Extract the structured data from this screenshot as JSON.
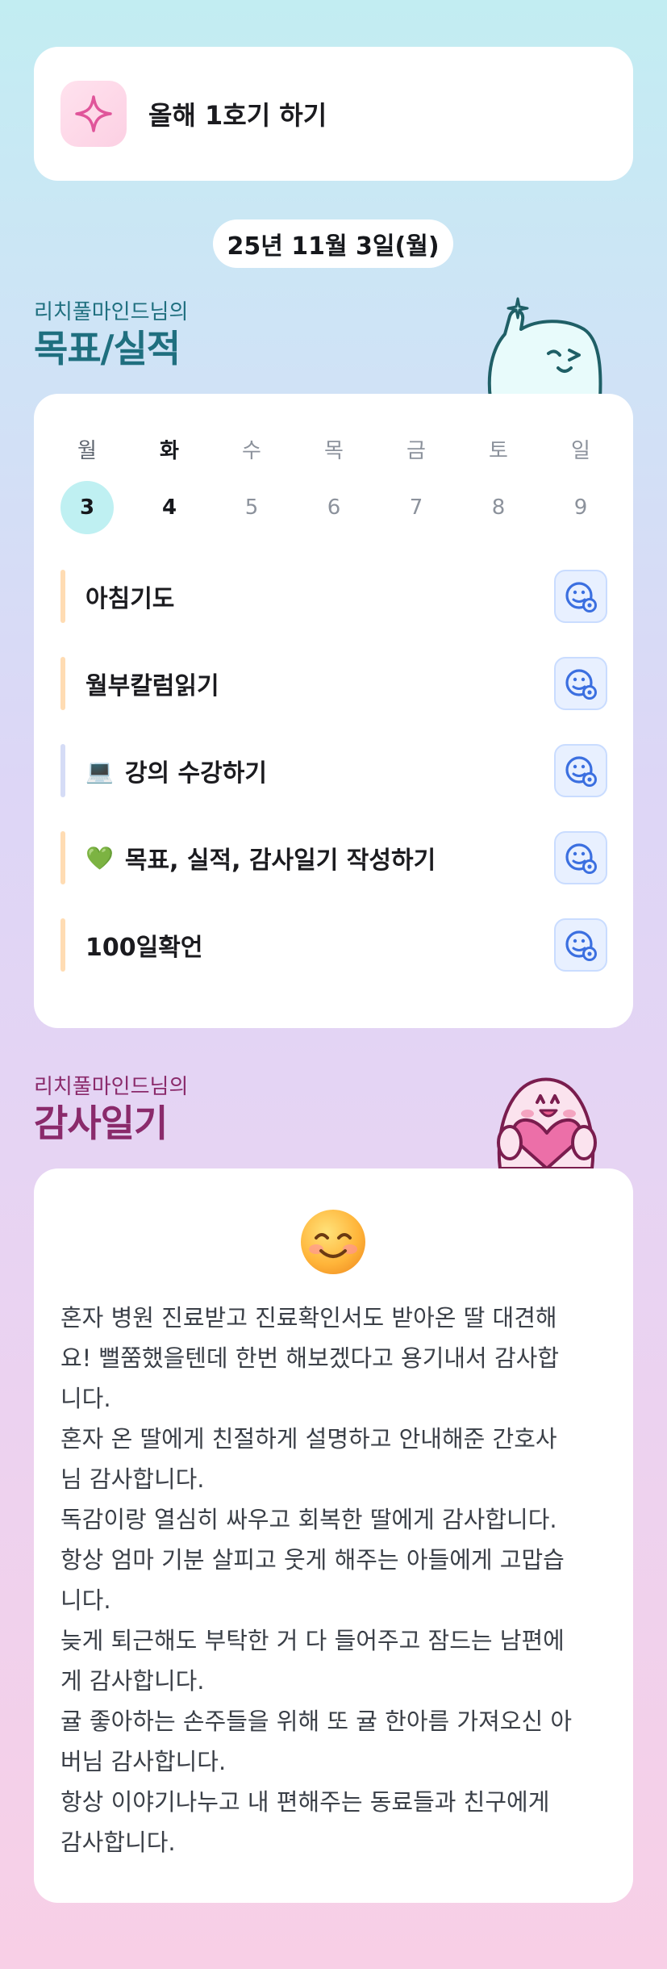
{
  "top": {
    "title": "올해 1호기 하기",
    "icon": "sparkle-icon"
  },
  "date": "25년 11월 3일(월)",
  "goals_section": {
    "subtitle": "리치풀마인드님의",
    "title": "목표/실적"
  },
  "week": {
    "days": [
      {
        "wd": "월",
        "date": "3",
        "state": "selected"
      },
      {
        "wd": "화",
        "date": "4",
        "state": "today"
      },
      {
        "wd": "수",
        "date": "5",
        "state": "future"
      },
      {
        "wd": "목",
        "date": "6",
        "state": "future"
      },
      {
        "wd": "금",
        "date": "7",
        "state": "future"
      },
      {
        "wd": "토",
        "date": "8",
        "state": "future"
      },
      {
        "wd": "일",
        "date": "9",
        "state": "future"
      }
    ]
  },
  "tasks": [
    {
      "label": "아침기도",
      "emoji": "",
      "bar_color": "#ffdcb3"
    },
    {
      "label": "월부칼럼읽기",
      "emoji": "",
      "bar_color": "#ffdcb3"
    },
    {
      "label": "강의 수강하기",
      "emoji": "💻",
      "bar_color": "#d5dcf6"
    },
    {
      "label": "목표, 실적, 감사일기 작성하기",
      "emoji": "💚",
      "bar_color": "#ffdcb3"
    },
    {
      "label": "100일확언",
      "emoji": "",
      "bar_color": "#ffdcb3"
    }
  ],
  "gratitude_section": {
    "subtitle": "리치풀마인드님의",
    "title": "감사일기"
  },
  "gratitude": {
    "mood_icon": "smiling-face-icon",
    "text": "혼자 병원 진료받고 진료확인서도 받아온 딸 대견해\n요! 뻘쭘했을텐데 한번 해보겠다고 용기내서 감사합\n니다.\n혼자 온 딸에게 친절하게 설명하고 안내해준 간호사\n님 감사합니다.\n독감이랑 열심히 싸우고 회복한 딸에게 감사합니다.\n항상 엄마 기분 살피고 웃게 해주는 아들에게 고맙습\n니다.\n늦게 퇴근해도 부탁한 거 다 들어주고 잠드는 남편에\n게 감사합니다.\n귤 좋아하는 손주들을 위해 또 귤 한아름 가져오신 아\n버님 감사합니다.\n항상 이야기나누고 내 편해주는 동료들과 친구에게\n감사합니다."
  },
  "colors": {
    "goals_title": "#1f6f7f",
    "gratitude_title": "#8a2a6b",
    "selected_date_bg": "#bff0f2",
    "accent_blue": "#3b6fe0"
  }
}
